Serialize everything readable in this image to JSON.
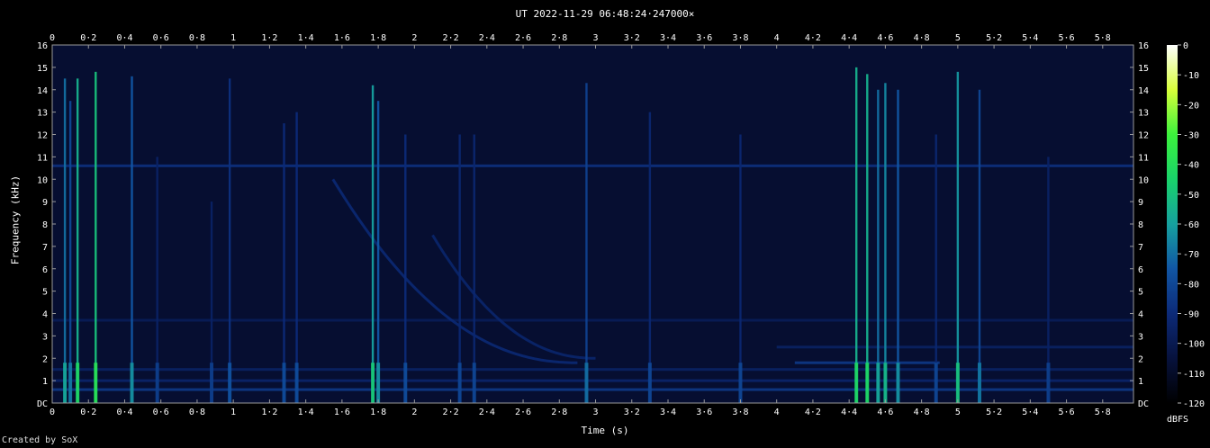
{
  "chart_data": {
    "type": "heatmap",
    "title": "UT 2022-11-29 06:48:24·247000×",
    "xlabel": "Time (s)",
    "ylabel": "Frequency (kHz)",
    "colorbar_label": "dBFS",
    "credit": "Created by SoX",
    "xlim": [
      0,
      5.97
    ],
    "ylim": [
      0,
      16
    ],
    "x_ticks": [
      "0",
      "0·2",
      "0·4",
      "0·6",
      "0·8",
      "1",
      "1·2",
      "1·4",
      "1·6",
      "1·8",
      "2",
      "2·2",
      "2·4",
      "2·6",
      "2·8",
      "3",
      "3·2",
      "3·4",
      "3·6",
      "3·8",
      "4",
      "4·2",
      "4·4",
      "4·6",
      "4·8",
      "5",
      "5·2",
      "5·4",
      "5·6",
      "5·8"
    ],
    "x_tick_values": [
      0,
      0.2,
      0.4,
      0.6,
      0.8,
      1,
      1.2,
      1.4,
      1.6,
      1.8,
      2,
      2.2,
      2.4,
      2.6,
      2.8,
      3,
      3.2,
      3.4,
      3.6,
      3.8,
      4,
      4.2,
      4.4,
      4.6,
      4.8,
      5,
      5.2,
      5.4,
      5.6,
      5.8
    ],
    "y_ticks": [
      "DC",
      "1",
      "2",
      "3",
      "4",
      "5",
      "6",
      "7",
      "8",
      "9",
      "10",
      "11",
      "12",
      "13",
      "14",
      "15",
      "16"
    ],
    "y_tick_values": [
      0,
      1,
      2,
      3,
      4,
      5,
      6,
      7,
      8,
      9,
      10,
      11,
      12,
      13,
      14,
      15,
      16
    ],
    "colorbar_ticks": [
      "0",
      "-10",
      "-20",
      "-30",
      "-40",
      "-50",
      "-60",
      "-70",
      "-80",
      "-90",
      "-100",
      "-110",
      "-120"
    ],
    "colorbar_values": [
      0,
      -10,
      -20,
      -30,
      -40,
      -50,
      -60,
      -70,
      -80,
      -90,
      -100,
      -110,
      -120
    ],
    "colorbar_range": [
      -120,
      0
    ],
    "colormap": [
      "#000000",
      "#07123d",
      "#0c2a78",
      "#1156a4",
      "#16a19f",
      "#19d36a",
      "#3cf23c",
      "#d8ff3a",
      "#ffffff"
    ],
    "background_level": -108,
    "events": {
      "sferics": [
        {
          "t": 0.07,
          "level": -70,
          "top": 14.5
        },
        {
          "t": 0.1,
          "level": -80,
          "top": 13.5
        },
        {
          "t": 0.14,
          "level": -55,
          "top": 14.5
        },
        {
          "t": 0.24,
          "level": -50,
          "top": 14.8
        },
        {
          "t": 0.44,
          "level": -75,
          "top": 14.6
        },
        {
          "t": 0.58,
          "level": -95,
          "top": 11
        },
        {
          "t": 0.88,
          "level": -95,
          "top": 9
        },
        {
          "t": 0.98,
          "level": -88,
          "top": 14.5
        },
        {
          "t": 1.28,
          "level": -90,
          "top": 12.5
        },
        {
          "t": 1.35,
          "level": -90,
          "top": 13
        },
        {
          "t": 1.77,
          "level": -60,
          "top": 14.2
        },
        {
          "t": 1.8,
          "level": -75,
          "top": 13.5
        },
        {
          "t": 1.95,
          "level": -90,
          "top": 12
        },
        {
          "t": 2.25,
          "level": -92,
          "top": 12
        },
        {
          "t": 2.33,
          "level": -92,
          "top": 12
        },
        {
          "t": 2.95,
          "level": -82,
          "top": 14.3
        },
        {
          "t": 3.3,
          "level": -92,
          "top": 13
        },
        {
          "t": 3.8,
          "level": -92,
          "top": 12
        },
        {
          "t": 4.44,
          "level": -55,
          "top": 15
        },
        {
          "t": 4.5,
          "level": -55,
          "top": 14.7
        },
        {
          "t": 4.56,
          "level": -70,
          "top": 14
        },
        {
          "t": 4.6,
          "level": -65,
          "top": 14.3
        },
        {
          "t": 4.67,
          "level": -75,
          "top": 14
        },
        {
          "t": 4.88,
          "level": -92,
          "top": 12
        },
        {
          "t": 5.0,
          "level": -62,
          "top": 14.8
        },
        {
          "t": 5.12,
          "level": -80,
          "top": 14
        },
        {
          "t": 5.5,
          "level": -95,
          "top": 11
        }
      ],
      "whistlers": [
        {
          "t0": 1.55,
          "f0": 10.0,
          "t1": 2.9,
          "f1": 1.8,
          "level": -90
        },
        {
          "t0": 2.1,
          "f0": 7.5,
          "t1": 3.0,
          "f1": 2.0,
          "level": -92
        }
      ],
      "tones": [
        {
          "f": 10.6,
          "t0": 0,
          "t1": 5.97,
          "level": -88
        },
        {
          "f": 0.6,
          "t0": 0,
          "t1": 5.97,
          "level": -85
        },
        {
          "f": 1.0,
          "t0": 0,
          "t1": 5.97,
          "level": -93
        },
        {
          "f": 1.5,
          "t0": 0,
          "t1": 5.97,
          "level": -95
        },
        {
          "f": 3.7,
          "t0": 0,
          "t1": 5.97,
          "level": -98
        },
        {
          "f": 2.5,
          "t0": 4.0,
          "t1": 5.97,
          "level": -95
        },
        {
          "f": 1.8,
          "t0": 4.1,
          "t1": 4.9,
          "level": -85
        }
      ]
    }
  }
}
